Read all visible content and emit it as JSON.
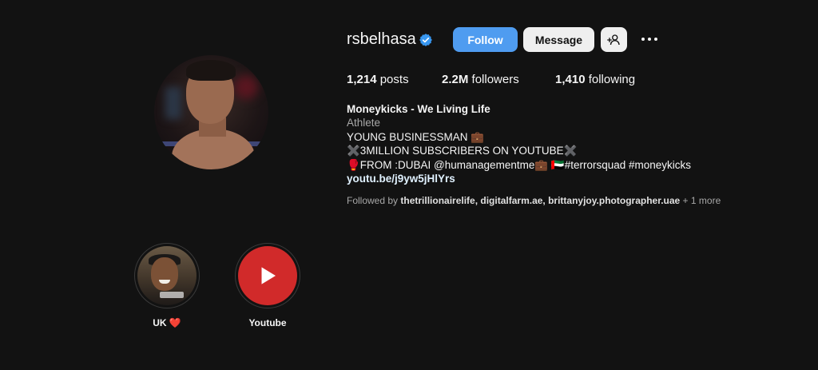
{
  "profile": {
    "username": "rsbelhasa",
    "verified": true
  },
  "actions": {
    "follow_label": "Follow",
    "message_label": "Message",
    "add_user_icon": "person-plus-icon",
    "more_icon": "more-options-icon"
  },
  "stats": {
    "posts_count": "1,214",
    "posts_label": "posts",
    "followers_count": "2.2M",
    "followers_label": "followers",
    "following_count": "1,410",
    "following_label": "following"
  },
  "bio": {
    "display_name": "Moneykicks - We Living Life",
    "category": "Athlete",
    "line1": "YOUNG BUSINESSMAN 💼",
    "line2": "✖️3MILLION SUBSCRIBERS ON YOUTUBE✖️",
    "line3": "🥊FROM :DUBAI @humanagementme💼 🇦🇪#terrorsquad #moneykicks",
    "link": "youtu.be/j9yw5jHlYrs"
  },
  "followed_by": {
    "prefix": "Followed by ",
    "names": "thetrillionairelife, digitalfarm.ae, brittanyjoy.photographer.uae",
    "suffix": " + 1 more"
  },
  "highlights": [
    {
      "label": "UK ❤️"
    },
    {
      "label": "Youtube"
    }
  ],
  "colors": {
    "background": "#121212",
    "follow_button": "#4f9cf0",
    "verified_badge": "#3897f0",
    "youtube_red": "#d12a2a"
  }
}
